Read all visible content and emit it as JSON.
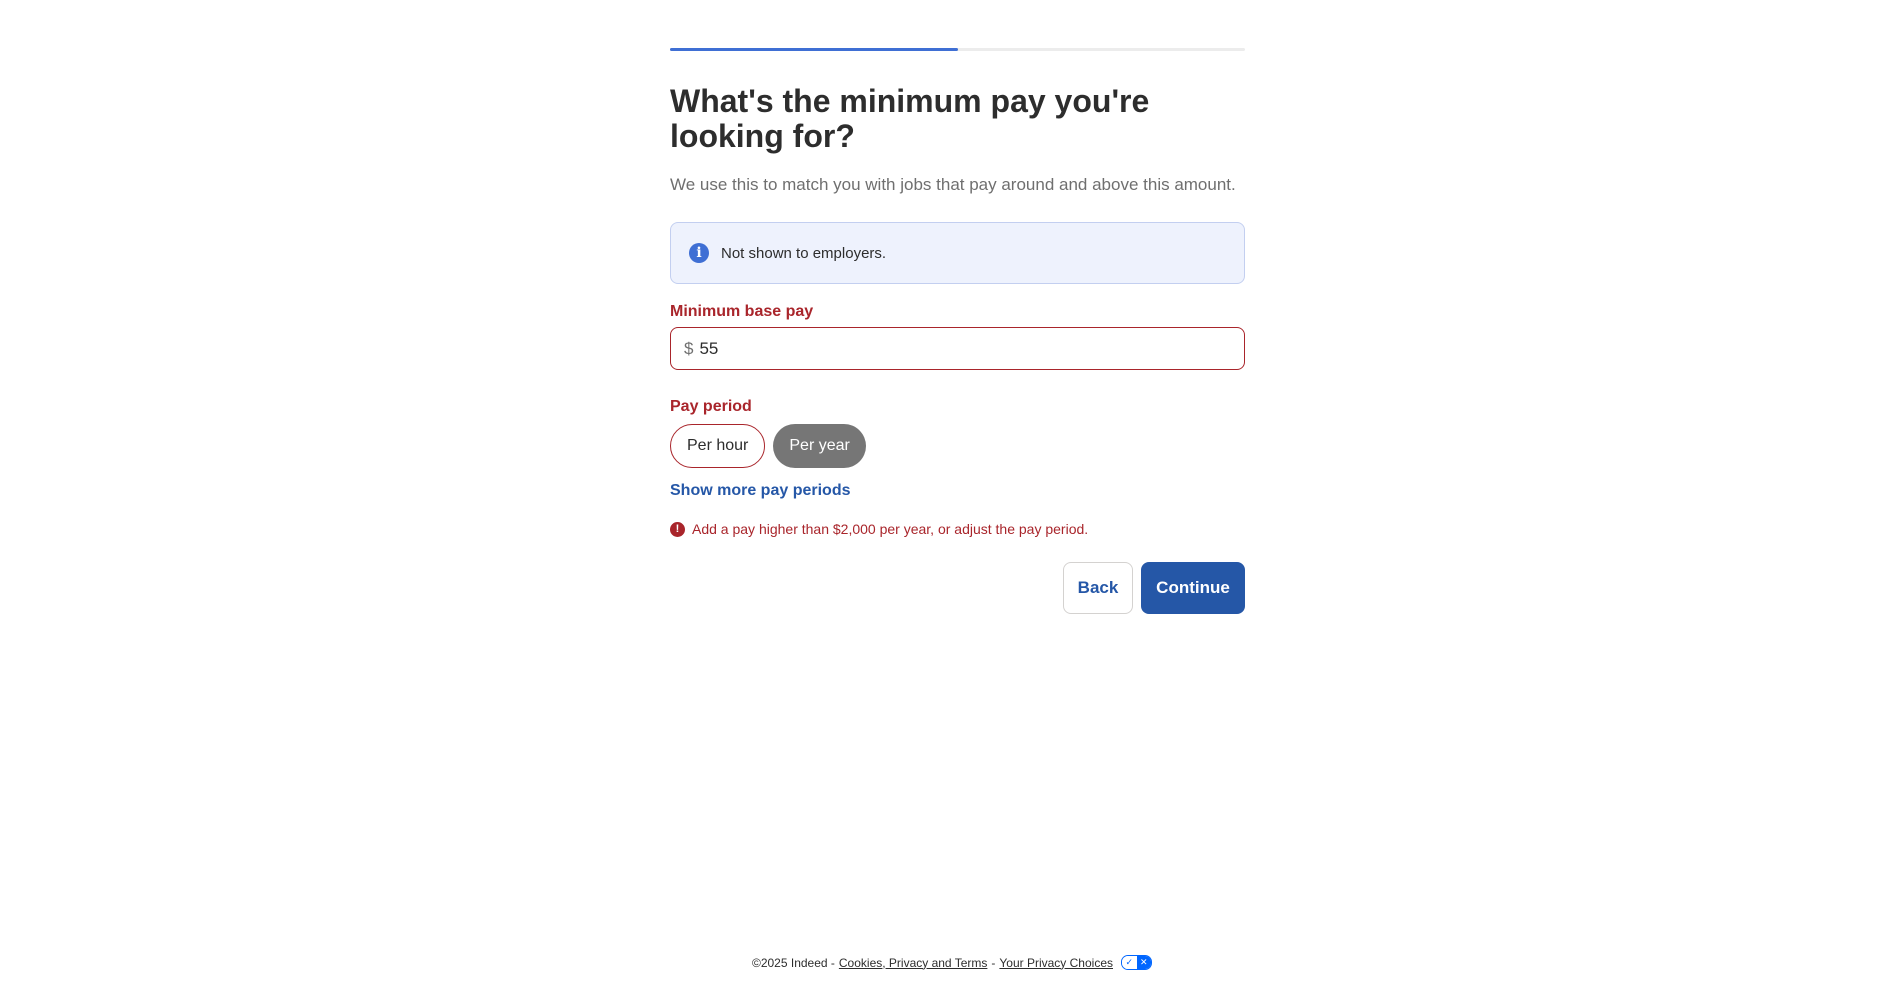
{
  "progress": {
    "fraction": 0.5
  },
  "heading": "What's the minimum pay you're looking for?",
  "subtitle": "We use this to match you with jobs that pay around and above this amount.",
  "info": {
    "icon": "info-icon",
    "text": "Not shown to employers."
  },
  "min_pay": {
    "label": "Minimum base pay",
    "currency": "$",
    "value": "55"
  },
  "pay_period": {
    "label": "Pay period",
    "options": [
      "Per hour",
      "Per year"
    ],
    "selected": "Per year",
    "more_link": "Show more pay periods"
  },
  "error": {
    "icon": "error-icon",
    "text": "Add a pay higher than $2,000 per year, or adjust the pay period."
  },
  "actions": {
    "back": "Back",
    "continue": "Continue"
  },
  "footer": {
    "copyright": "©2025 Indeed -",
    "cookies_link": "Cookies, Privacy and Terms",
    "separator": "-",
    "privacy_link": "Your Privacy Choices",
    "privacy_icon": "privacy-choices-icon"
  },
  "colors": {
    "accent": "#2557a7",
    "progress": "#3f6fd4",
    "error": "#a9252b",
    "selected_pill": "#767676"
  }
}
